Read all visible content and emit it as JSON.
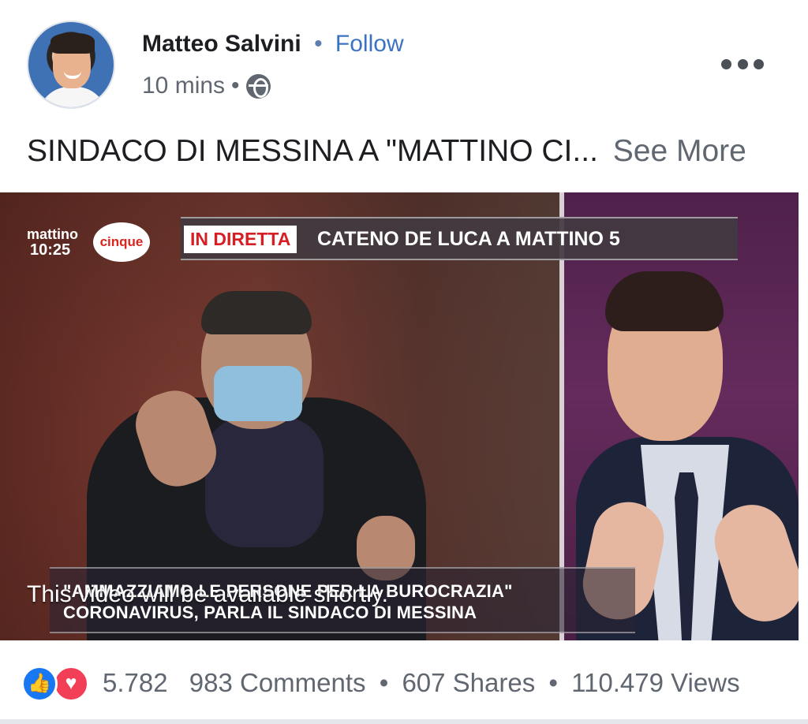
{
  "post": {
    "author": "Matteo Salvini",
    "separator": "•",
    "follow_label": "Follow",
    "time": "10 mins",
    "meta_separator": "•",
    "privacy_icon": "globe-icon",
    "more_icon": "more-options-icon",
    "caption": "SINDACO DI MESSINA A \"MATTINO CI...",
    "see_more": "See More"
  },
  "video": {
    "logo_word": "mattino",
    "logo_cinque": "cinque",
    "logo_time": "10:25",
    "banner_live": "IN DIRETTA",
    "banner_title": "CATENO DE LUCA A MATTINO 5",
    "quote": "\"AMMAZZIAMO LE PERSONE PER LA BUROCRAZIA\"",
    "subtitle": "CORONAVIRUS, PARLA IL SINDACO DI MESSINA",
    "overlay_text": "This video will be available shortly."
  },
  "stats": {
    "like_icon": "like-reaction-icon",
    "love_icon": "love-reaction-icon",
    "reactions": "5.782",
    "comments": "983 Comments",
    "separator1": "•",
    "shares": "607 Shares",
    "separator2": "•",
    "views": "110.479 Views"
  },
  "colors": {
    "follow": "#3b73c4",
    "meta": "#606770",
    "live_red": "#d51f24",
    "like_blue": "#1877f2",
    "love_red": "#f33e58"
  }
}
